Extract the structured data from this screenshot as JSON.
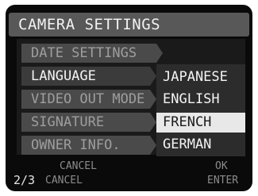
{
  "title": "CAMERA SETTINGS",
  "menu": {
    "items": [
      {
        "label": "DATE SETTINGS"
      },
      {
        "label": "LANGUAGE"
      },
      {
        "label": "VIDEO OUT MODE"
      },
      {
        "label": "SIGNATURE"
      },
      {
        "label": "OWNER INFO."
      }
    ],
    "active_item": "LANGUAGE"
  },
  "language_options": {
    "options": [
      "JAPANESE",
      "ENGLISH",
      "FRENCH",
      "GERMAN"
    ],
    "selected": "FRENCH"
  },
  "footer": {
    "row1_cancel": "CANCEL",
    "row1_ok": "OK",
    "page": "2/3",
    "row2_cancel": "CANCEL",
    "row2_enter": "ENTER"
  }
}
